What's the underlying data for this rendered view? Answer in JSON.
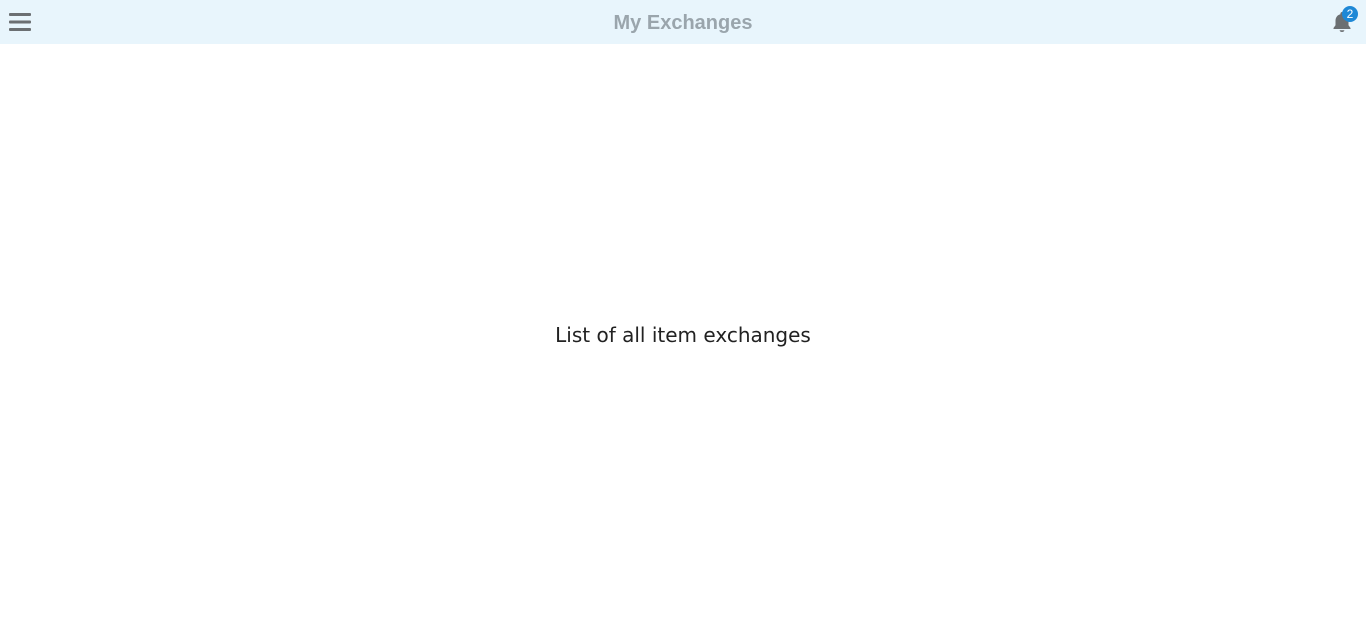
{
  "header": {
    "title": "My Exchanges",
    "menu_icon": "hamburger-menu-icon",
    "notifications_icon": "bell-icon",
    "notification_count": "2",
    "background_color": "#e8f5fc",
    "title_color": "#9aa5ac",
    "badge_color": "#1e88d6"
  },
  "main": {
    "message": "List of all item exchanges"
  }
}
